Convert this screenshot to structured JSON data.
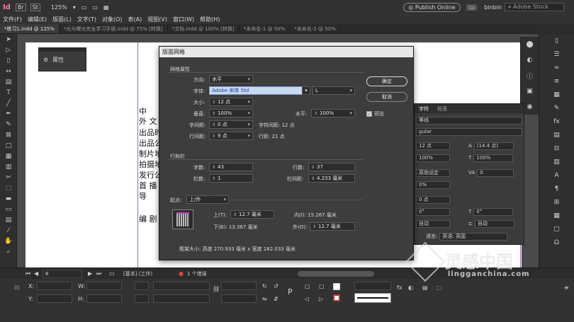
{
  "topbar": {
    "app_icon": "Id",
    "br_icon": "Br",
    "st_icon": "St",
    "zoom": "125%",
    "publish_button": "Publish Online",
    "user": "binbin",
    "search_placeholder": "Adobe Stock"
  },
  "menubar": [
    "文件(F)",
    "编辑(E)",
    "版面(L)",
    "文字(T)",
    "对象(O)",
    "表(A)",
    "视图(V)",
    "窗口(W)",
    "帮助(H)"
  ],
  "tabs": [
    {
      "label": "*练习1.indd @ 125%",
      "active": true
    },
    {
      "label": "*光与曝光完全学习手册.indd @ 75% [转换]",
      "active": false
    },
    {
      "label": "*文档.indd @ 100% [转换]",
      "active": false
    },
    {
      "label": "*未命名-1 @ 50%",
      "active": false
    },
    {
      "label": "*未命名-2 @ 50%",
      "active": false
    }
  ],
  "properties_panel": {
    "label": "属性"
  },
  "page_text": {
    "line1": "中",
    "line2": "外 文",
    "line3": "出品时",
    "line4": "出品公",
    "line5": "制片地",
    "line6": "拍摄地",
    "line7": "发行公",
    "line8": "首 播",
    "line9": "导",
    "line10": "编 剧"
  },
  "dialog": {
    "title": "版面网格",
    "section_grid": "网格属性",
    "direction_label": "方向:",
    "direction_value": "水平",
    "font_label": "字体:",
    "font_value": "Adobe 宋体 Std",
    "font_style_value": "L",
    "size_label": "大小:",
    "size_value": "12 点",
    "vertical_label": "垂直:",
    "vertical_value": "100%",
    "horizontal_label": "水平:",
    "horizontal_value": "100%",
    "char_spacing_label": "字间距:",
    "char_spacing_value": "0 点",
    "char_pitch_label": "字符间距: 12 点",
    "line_spacing_label": "行间距:",
    "line_spacing_value": "9 点",
    "line_pitch_label": "行距: 21 点",
    "section_rows": "行和栏",
    "chars_label": "字数:",
    "chars_value": "43",
    "lines_label": "行数:",
    "lines_value": "37",
    "columns_label": "栏数:",
    "columns_value": "1",
    "gutter_label": "栏间距:",
    "gutter_value": "4.233 毫米",
    "origin_label": "起点:",
    "origin_value": "上/外",
    "top_label": "上(T):",
    "top_value": "12.7 毫米",
    "inside_label": "内(I): 15.267 毫米",
    "bottom_label": "下(B): 13.367 毫米",
    "outside_label": "外(O):",
    "outside_value": "12.7 毫米",
    "frame_size": "框架大小: 高度 270.933 毫米 x 宽度 182.033 毫米",
    "ok_button": "确定",
    "cancel_button": "取消",
    "preview_label": "预览",
    "preview_checked": true
  },
  "char_panel": {
    "tab_char": "字符",
    "tab_para": "段落",
    "font_family": "等线",
    "font_style": "gular",
    "size": "12 点",
    "leading": "(14.4 点)",
    "vscale": "100%",
    "hscale": "100%",
    "kerning": "原始设定",
    "tracking": "0",
    "tsume": "0%",
    "baseline": "0 点",
    "skew": "0°",
    "rotate": "0°",
    "auto1": "自动",
    "auto2": "自动",
    "language_label": "语言:",
    "language_value": "英语: 英国"
  },
  "statusbar": {
    "page": "8",
    "state": "[基本] (工作)",
    "errors": "1 个错误"
  },
  "bottombar": {
    "x_label": "X:",
    "y_label": "Y:",
    "w_label": "W:",
    "h_label": "H:"
  },
  "watermark": {
    "brand": "灵感中国",
    "url": "lingganchina.com"
  },
  "colors": {
    "accent": "#a060c0",
    "dialog_bg": "#3d3d3d",
    "selection": "#c9d9f0"
  }
}
